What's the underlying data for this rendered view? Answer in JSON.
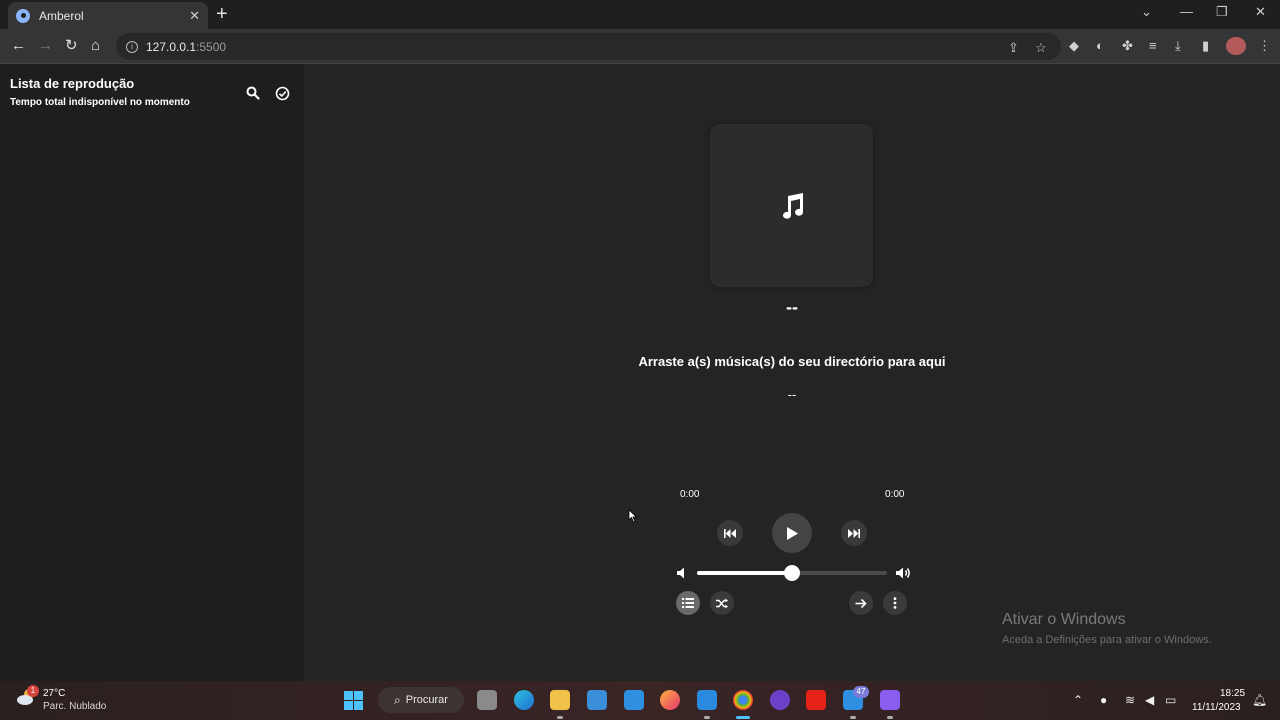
{
  "browser": {
    "tab_title": "Amberol",
    "tab_close": "✕",
    "new_tab": "+",
    "url_host": "127.0.0.1",
    "url_port": ":5500"
  },
  "sidebar": {
    "title": "Lista de reprodução",
    "subtitle": "Tempo total indisponível no momento"
  },
  "player": {
    "song_title": "--",
    "artist": "Arraste a(s) música(s) do seu directório para aqui",
    "album": "--",
    "elapsed": "0:00",
    "remaining": "0:00",
    "volume_level": 0.5
  },
  "watermark": {
    "title": "Ativar o Windows",
    "subtitle": "Aceda a Definições para ativar o Windows."
  },
  "taskbar": {
    "weather_badge": "1",
    "temperature": "27°C",
    "weather_desc": "Parc. Nublado",
    "search_label": "Procurar",
    "app_badge": "47",
    "time": "18:25",
    "date": "11/11/2023"
  },
  "colors": {
    "app_background": "#242424",
    "sidebar_background": "#1e1e1e",
    "accent": "#4cc2ff"
  }
}
